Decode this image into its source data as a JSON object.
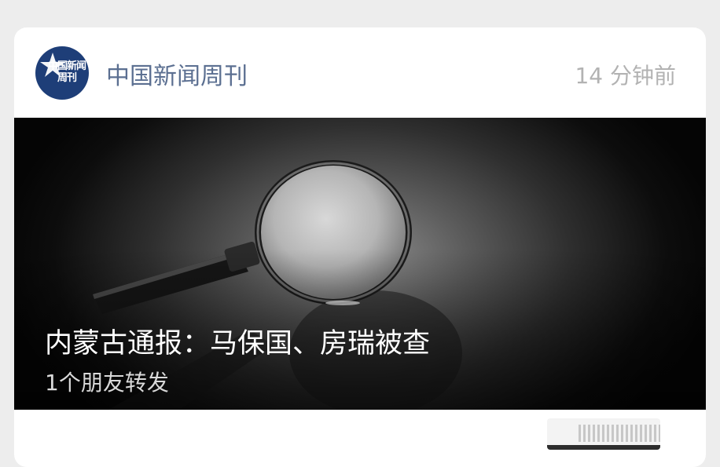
{
  "header": {
    "avatar_text": "中国新闻周刊",
    "account_name": "中国新闻周刊",
    "time": "14 分钟前"
  },
  "article": {
    "title": "内蒙古通报：马保国、房瑞被查",
    "forward_note": "1个朋友转发",
    "image_subject": "magnifying-glass"
  },
  "colors": {
    "avatar_bg": "#1e3e78",
    "account_name": "#5b6f91",
    "time": "#b2b2b2",
    "page_bg": "#ededed"
  }
}
